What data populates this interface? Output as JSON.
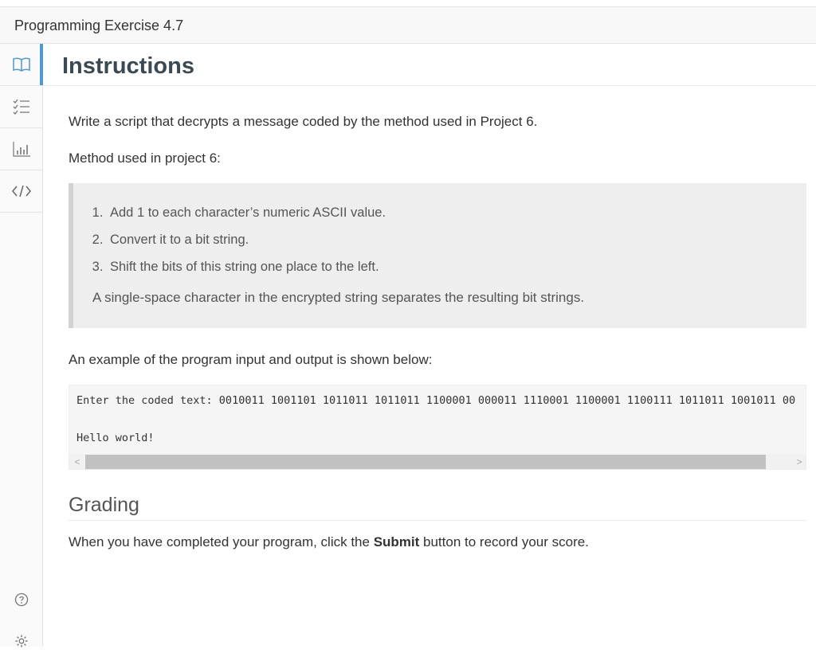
{
  "header": {
    "title": "Programming Exercise 4.7"
  },
  "sidebar": {
    "items": [
      {
        "icon": "book-icon",
        "active": true
      },
      {
        "icon": "checklist-icon",
        "active": false
      },
      {
        "icon": "bar-chart-icon",
        "active": false
      },
      {
        "icon": "code-icon",
        "active": false
      }
    ],
    "bottom": [
      {
        "icon": "help-icon"
      },
      {
        "icon": "gear-icon"
      }
    ],
    "accent": "#4a9ad4"
  },
  "main": {
    "heading": "Instructions",
    "intro": "Write a script that decrypts a message coded by the method used in Project 6.",
    "method_label": "Method used in project 6:",
    "steps": [
      "Add 1 to each character’s numeric ASCII value.",
      "Convert it to a bit string.",
      "Shift the bits of this string one place to the left."
    ],
    "note": "A single-space character in the encrypted string separates the resulting bit strings.",
    "example_label": "An example of the program input and output is shown below:",
    "code": {
      "line1": "Enter the coded text: 0010011 1001101 1011011 1011011 1100001 000011 1110001 1100001 1100111 1011011 1001011 00",
      "line2": "Hello world!",
      "scroll_left": "<",
      "scroll_right": ">"
    },
    "grading_heading": "Grading",
    "grading_before": "When you have completed your program, click the ",
    "grading_bold": "Submit",
    "grading_after": " button to record your score."
  }
}
